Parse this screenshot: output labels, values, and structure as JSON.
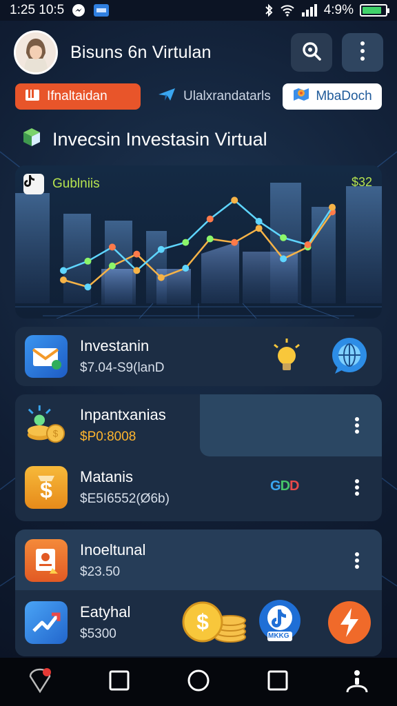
{
  "status_bar": {
    "time": "1:25 10:5",
    "battery_percent": "4:9%",
    "battery_level": 0.85,
    "icons": [
      "messenger-icon",
      "app-badge-icon",
      "bluetooth-icon",
      "wifi-icon",
      "signal-icon",
      "battery-icon"
    ]
  },
  "header": {
    "title": "Bisuns 6n Virtulan",
    "avatar": "user-avatar",
    "search_icon": "search-icon",
    "more_icon": "more-vertical-icon"
  },
  "tabs": [
    {
      "label": "Ifnaltaidan",
      "icon": "wallet-icon",
      "color": "#e8552a"
    },
    {
      "label": "Ulalxrandatarls",
      "icon": "plane-icon"
    },
    {
      "label": "MbaDoch",
      "icon": "map-icon",
      "color": "#ffffff"
    }
  ],
  "section": {
    "title": "Invecsin Investasin Virtual",
    "icon": "cube-icon"
  },
  "chart": {
    "label": "Gublniis",
    "value": "$32"
  },
  "chart_data": {
    "type": "line",
    "title": "",
    "xlabel": "",
    "ylabel": "",
    "series": [
      {
        "values": [
          20,
          14,
          32,
          42,
          22,
          30,
          55,
          52,
          64,
          38,
          48,
          78
        ]
      },
      {
        "values": [
          28,
          36,
          48,
          28,
          46,
          52,
          72,
          88,
          70,
          56,
          50,
          82
        ]
      }
    ],
    "colors": [
      "#f6b347",
      "#5fd6ff",
      "#8cf66a",
      "#ff7a4a"
    ],
    "ylim": [
      0,
      100
    ],
    "grid": true
  },
  "cards": [
    {
      "rows": [
        {
          "title": "Investanin",
          "subtitle": "$7.04-S9(lanD",
          "icon": "mail-icon",
          "accessories": [
            "lightbulb-icon",
            "globe-chat-icon"
          ]
        }
      ]
    },
    {
      "rows": [
        {
          "title": "Inpantxanias",
          "subtitle": "$P0:8008",
          "icon": "coins-icon",
          "menu": "more-vertical-icon"
        },
        {
          "title": "Matanis",
          "subtitle": "$E5I6552(Ø6b)",
          "icon": "dollar-bag-icon",
          "badge": "GDD",
          "menu": "more-vertical-icon"
        }
      ]
    },
    {
      "rows": [
        {
          "title": "Inoeltunal",
          "subtitle": "$23.50",
          "icon": "document-icon",
          "menu": "more-vertical-icon"
        },
        {
          "title": "Eatyhal",
          "subtitle": "$5300",
          "icon": "trend-icon",
          "accessories": [
            "coin-stack-icon",
            "tiktok-icon",
            "flash-icon"
          ],
          "badge_text": "MKKG"
        }
      ]
    }
  ],
  "nav": [
    "back-icon",
    "recents-square-icon",
    "home-circle-icon",
    "overview-square-icon",
    "account-icon"
  ]
}
